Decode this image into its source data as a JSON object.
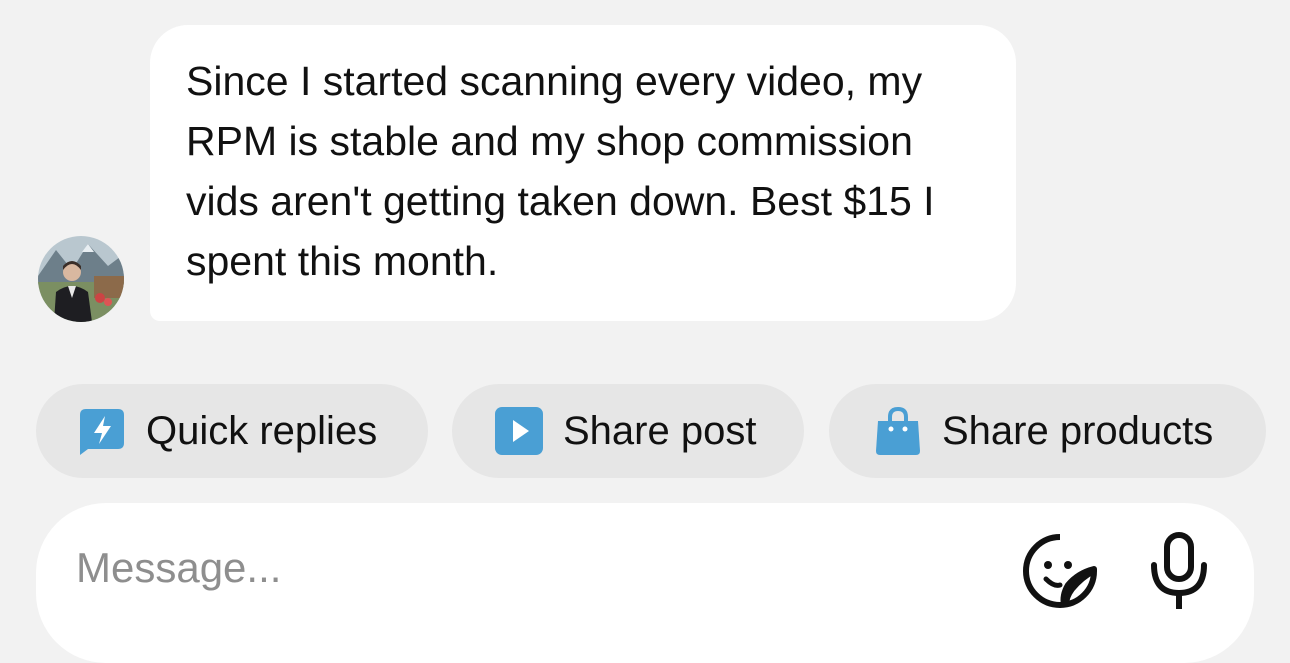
{
  "message": {
    "text": "Since I started scanning every video, my RPM is stable and my shop commission vids aren't getting taken down. Best $15 I spent this month."
  },
  "avatar": {
    "icon": "profile-photo"
  },
  "quick_actions": [
    {
      "label": "Quick replies",
      "icon": "quick-replies-icon",
      "color": "#4a9fd4"
    },
    {
      "label": "Share post",
      "icon": "play-icon",
      "color": "#4a9fd4"
    },
    {
      "label": "Share products",
      "icon": "shopping-bag-icon",
      "color": "#4a9fd4"
    }
  ],
  "composer": {
    "placeholder": "Message...",
    "emoji_icon": "sticker-icon",
    "mic_icon": "microphone-icon"
  },
  "colors": {
    "background": "#f2f2f2",
    "bubble": "#ffffff",
    "chip": "#e6e6e6",
    "accent": "#4a9fd4"
  }
}
